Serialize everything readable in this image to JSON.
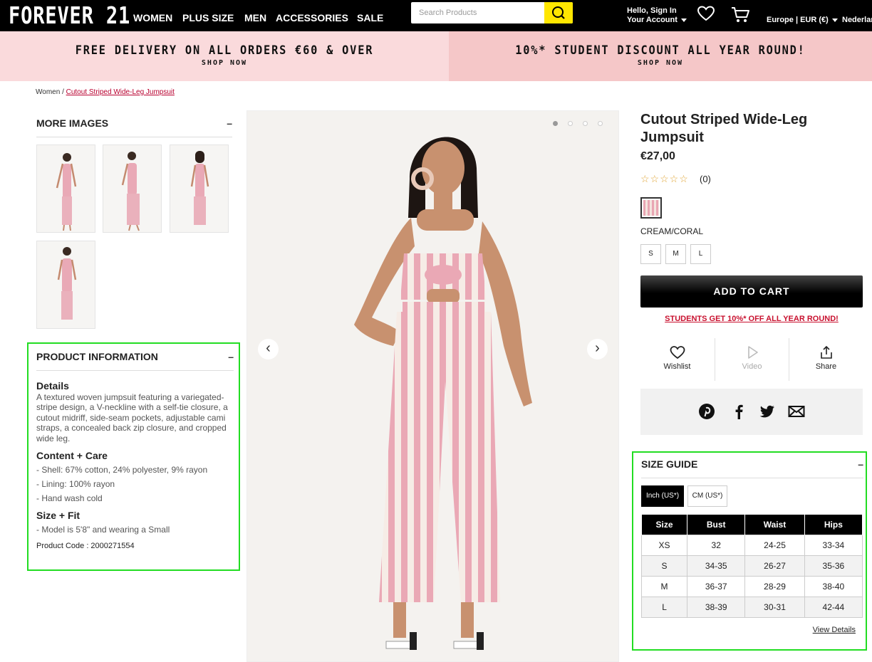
{
  "header": {
    "logo": "FOREVER 21",
    "nav": [
      "WOMEN",
      "PLUS SIZE",
      "MEN",
      "ACCESSORIES",
      "SALE"
    ],
    "search_placeholder": "Search Products",
    "account_line1": "Hello, Sign In",
    "account_line2": "Your Account",
    "region": "Europe | EUR (€)",
    "language": "Nederlan"
  },
  "promos": [
    {
      "title": "FREE DELIVERY ON ALL ORDERS €60 & OVER",
      "cta": "SHOP NOW",
      "bg": "#fadadc"
    },
    {
      "title": "10%* STUDENT DISCOUNT ALL YEAR ROUND!",
      "cta": "SHOP NOW",
      "bg": "#f5c7c8"
    }
  ],
  "breadcrumb": {
    "root": "Women",
    "separator": "/",
    "current": "Cutout Striped Wide-Leg Jumpsuit"
  },
  "more_images": {
    "title": "MORE IMAGES",
    "toggle": "–",
    "count": 4
  },
  "product_info": {
    "title": "PRODUCT INFORMATION",
    "toggle": "–",
    "details_heading": "Details",
    "details_text": "A textured woven jumpsuit featuring a variegated-stripe design, a V-neckline with a self-tie closure, a cutout midriff, side-seam pockets, adjustable cami straps, a concealed back zip closure, and cropped wide leg.",
    "care_heading": "Content + Care",
    "care_items": [
      "- Shell: 67% cotton, 24% polyester, 9% rayon",
      "- Lining: 100% rayon",
      "- Hand wash cold"
    ],
    "fit_heading": "Size + Fit",
    "fit_items": [
      "- Model is 5'8\" and wearing a Small"
    ],
    "product_code": "Product Code : 2000271554"
  },
  "gallery": {
    "slides": 4,
    "active_slide": 1,
    "prev_icon": "chevron-left-icon",
    "next_icon": "chevron-right-icon"
  },
  "product": {
    "name": "Cutout Striped Wide-Leg Jumpsuit",
    "price": "€27,00",
    "rating": 0,
    "stars": "☆☆☆☆☆",
    "review_count": "(0)",
    "color_name": "CREAM/CORAL",
    "sizes": [
      "S",
      "M",
      "L"
    ],
    "add_to_cart": "ADD TO CART",
    "student_link": "STUDENTS GET 10%* OFF ALL YEAR ROUND!",
    "actions": [
      {
        "label": "Wishlist",
        "icon": "heart-icon"
      },
      {
        "label": "Video",
        "icon": "play-icon"
      },
      {
        "label": "Share",
        "icon": "share-icon"
      }
    ],
    "social_icons": [
      "pinterest-icon",
      "facebook-icon",
      "twitter-icon",
      "email-icon"
    ]
  },
  "size_guide": {
    "title": "SIZE GUIDE",
    "toggle": "–",
    "units": [
      "Inch (US*)",
      "CM (US*)"
    ],
    "active_unit": "Inch (US*)",
    "columns": [
      "Size",
      "Bust",
      "Waist",
      "Hips"
    ],
    "rows": [
      [
        "XS",
        "32",
        "24-25",
        "33-34"
      ],
      [
        "S",
        "34-35",
        "26-27",
        "35-36"
      ],
      [
        "M",
        "36-37",
        "28-29",
        "38-40"
      ],
      [
        "L",
        "38-39",
        "30-31",
        "42-44"
      ]
    ],
    "view_details": "View Details"
  },
  "colors": {
    "accent_yellow": "#ffe600",
    "link_red": "#c8102e",
    "highlight_green": "#22dd22"
  }
}
